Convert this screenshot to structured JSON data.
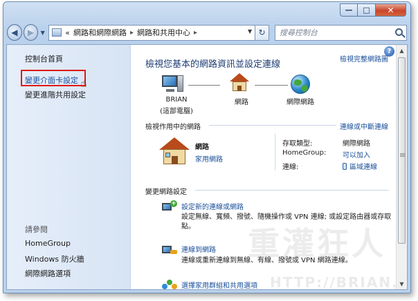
{
  "window": {
    "caption": {
      "minimize": "—",
      "maximize": "□",
      "close": "✕"
    }
  },
  "navbar": {
    "back_icon": "back-arrow-icon",
    "forward_icon": "forward-arrow-icon",
    "overflow": "«",
    "breadcrumbs": [
      "網路和網際網路",
      "網路和共用中心"
    ],
    "separator": "▸",
    "search_placeholder": "搜尋控制台"
  },
  "sidebar": {
    "home": "控制台首頁",
    "links": [
      "變更介面卡設定",
      "變更進階共用設定"
    ],
    "see_also_label": "請參閱",
    "see_also": [
      "HomeGroup",
      "Windows 防火牆",
      "網際網路選項"
    ]
  },
  "main": {
    "title": "檢視您基本的網路資訊並設定連線",
    "full_map_link": "檢視完整網路圖",
    "map_nodes": [
      {
        "label": "BRIAN",
        "sub": "(這部電腦)"
      },
      {
        "label": "網路",
        "sub": ""
      },
      {
        "label": "網際網路",
        "sub": ""
      }
    ],
    "active_networks_heading": "檢視作用中的網路",
    "connect_disconnect_link": "連線或中斷連線",
    "network": {
      "name": "網路",
      "type": "家用網路"
    },
    "details": [
      {
        "key": "存取類型:",
        "value": "網際網路"
      },
      {
        "key": "HomeGroup:",
        "value": "可以加入"
      },
      {
        "key": "連線:",
        "value": "區域連線"
      }
    ],
    "change_settings_heading": "變更網路設定",
    "tasks": [
      {
        "link": "設定新的連線或網路",
        "desc": "設定無線、寬頻、撥號、隨機操作或 VPN 連線; 或設定路由器或存取點。"
      },
      {
        "link": "連線到網路",
        "desc": "連線或重新連線到無線、有線、撥號或 VPN 網路連線。"
      },
      {
        "link": "選擇家用群組和共用選項",
        "desc": ""
      }
    ],
    "help_icon": "?"
  },
  "watermark": {
    "line1": "重灌狂人",
    "line2": "HTTP://BRIAN.COM"
  },
  "colors": {
    "link": "#1a4f9a",
    "title": "#1e3d74",
    "highlight": "#e0190e",
    "chrome": "#b9d1ec"
  }
}
